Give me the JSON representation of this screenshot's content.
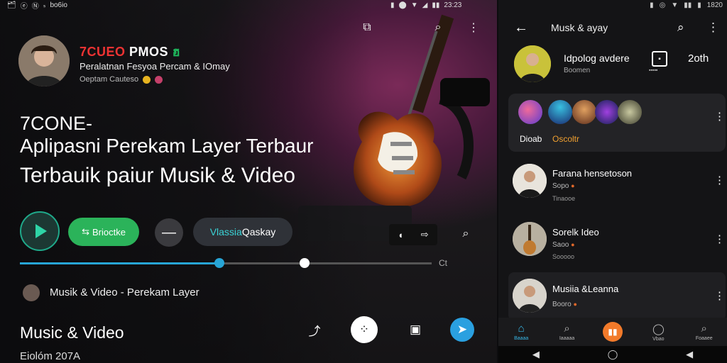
{
  "left": {
    "status_left": [
      "🗂",
      "ⓔ",
      "Ⓝ",
      "ₛ",
      "bo6io"
    ],
    "status_right": [
      "▮",
      "⬤",
      "▼",
      "◢",
      "▮▮",
      "23:23"
    ],
    "brand": {
      "part1": "7CUEO",
      "part2": "PMOS",
      "part3": "ฮ"
    },
    "subtitle": "Peralatnan Fesyoa Percam & IOmay",
    "meta": "Oeptam Cauteso",
    "headline": {
      "line1": "7CONE-",
      "line2": "Aplipasni Perekam Layer Terbaur",
      "line3": "Terbauik paiur Musik & Video"
    },
    "green_button": "Brioctke",
    "green_button_icon": "⇆",
    "minus_button": "—",
    "pill_button": {
      "accent": "Vlassia",
      "rest": " Qaskay"
    },
    "progress": {
      "played": 0.485,
      "buffered": 0.691
    },
    "progress_end": "Ct",
    "now_playing": "Musik & Video - Perekam Layer",
    "section_title": "Music & Video",
    "section_date": "Eiolóm 207A",
    "colors": {
      "accent_blue": "#27a5d6",
      "green": "#2bb35a",
      "teal": "#2ed4a6"
    }
  },
  "right": {
    "status": [
      "▮",
      "◎",
      "▼",
      "▮▮",
      "▮",
      "1820"
    ],
    "title": "Musk & ayay",
    "profile": {
      "name": "Idpolog avdere",
      "sub": "Boomen",
      "icon_label": "▪▪▪▪▪",
      "count": "2oth"
    },
    "card": {
      "label1": "Dioab",
      "label2": "Oscoltr"
    },
    "rows": [
      {
        "title": "Farana hensetoson",
        "sub": "Sopo",
        "sub2": "Tinaooe"
      },
      {
        "title": "Sorelk Ideo",
        "sub": "Saoo",
        "sub2": "Sooooo"
      },
      {
        "title": "Musiia &Leanna",
        "sub": "Booro",
        "sub2": ""
      }
    ],
    "nav": [
      {
        "icon": "⌂",
        "label": "Baaaa"
      },
      {
        "icon": "⌕",
        "label": "Iaaaaa"
      },
      {
        "icon": "▮▮",
        "label": ""
      },
      {
        "icon": "◯",
        "label": "Vbao"
      },
      {
        "icon": "⌕",
        "label": "Foaaee"
      }
    ],
    "sysnav": [
      "◀",
      "◯",
      "◀"
    ]
  }
}
